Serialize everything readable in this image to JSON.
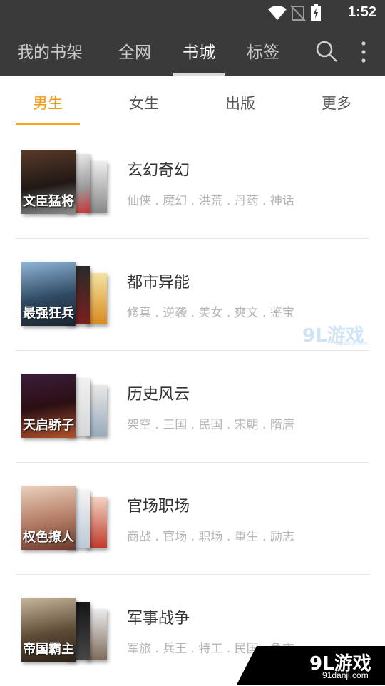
{
  "status_bar": {
    "time": "1:52"
  },
  "top_nav": {
    "tabs": [
      {
        "label": "我的书架"
      },
      {
        "label": "全网"
      },
      {
        "label": "书城"
      },
      {
        "label": "标签"
      }
    ],
    "active_index": 2
  },
  "sub_tabs": {
    "tabs": [
      {
        "label": "男生"
      },
      {
        "label": "女生"
      },
      {
        "label": "出版"
      },
      {
        "label": "更多"
      }
    ],
    "active_index": 0,
    "accent_color": "#f39c12"
  },
  "genres": [
    {
      "title": "玄幻奇幻",
      "tags": "仙侠 . 魔幻 . 洪荒 . 丹药 . 神话",
      "cover_text": "文臣猛将"
    },
    {
      "title": "都市异能",
      "tags": "修真 . 逆袭 . 美女 . 爽文 . 鉴宝",
      "cover_text": "最强狂兵"
    },
    {
      "title": "历史风云",
      "tags": "架空 . 三国 . 民国 . 宋朝 . 隋唐",
      "cover_text": "天启骄子"
    },
    {
      "title": "官场职场",
      "tags": "商战 . 官场 . 职场 . 重生 . 励志",
      "cover_text": "权色撩人"
    },
    {
      "title": "军事战争",
      "tags": "军旅 . 兵王 . 特工 . 民国 . 争霸",
      "cover_text": "帝国霸主"
    }
  ],
  "watermark": {
    "brand": "9L游戏",
    "site": "91danji.com"
  }
}
